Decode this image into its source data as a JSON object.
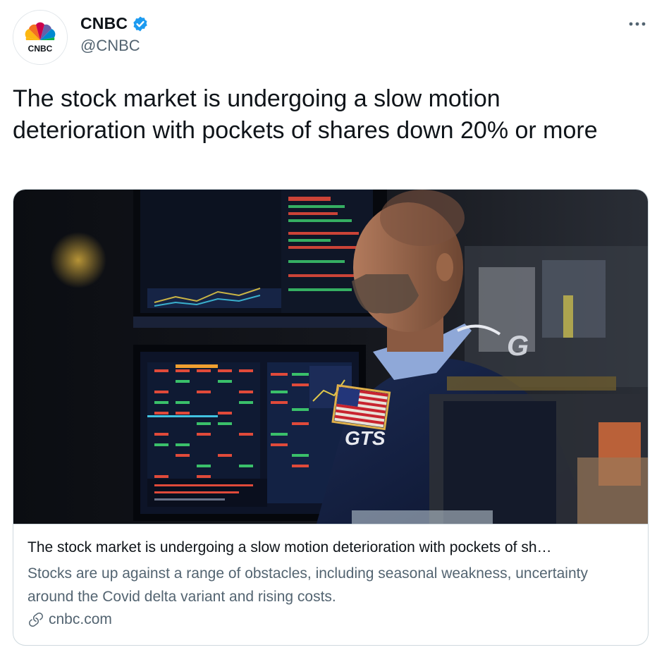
{
  "account": {
    "display_name": "CNBC",
    "handle": "@CNBC",
    "verified": true,
    "logo_text": "CNBC",
    "verified_color": "#1d9bf0"
  },
  "tweet": {
    "text": "The stock market is undergoing a slow motion deterioration with pockets of shares down 20% or more"
  },
  "card": {
    "image_icon": "trader-at-monitors-photo",
    "title": "The stock market is undergoing a slow motion deterioration with pockets of sh…",
    "description": "Stocks are up against a range of obstacles, including seasonal weakness, uncertainty around the Covid delta variant and rising costs.",
    "domain": "cnbc.com"
  },
  "icons": {
    "more": "more-horizontal-icon",
    "verified": "verified-badge-icon",
    "link": "link-icon"
  },
  "colors": {
    "text_primary": "#0f1419",
    "text_secondary": "#536471",
    "border": "#cfd9de"
  }
}
